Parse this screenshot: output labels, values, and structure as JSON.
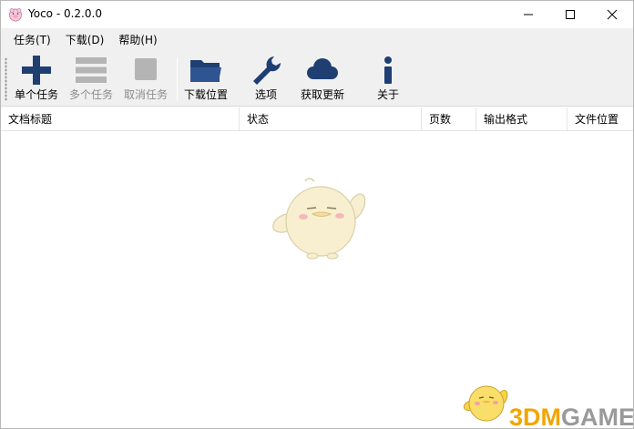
{
  "window": {
    "title": "Yoco - 0.2.0.0",
    "icon": "pink-piglet-app-icon"
  },
  "menu": [
    {
      "label": "任务(T)"
    },
    {
      "label": "下载(D)"
    },
    {
      "label": "帮助(H)"
    }
  ],
  "toolbar": {
    "items": [
      {
        "label": "单个任务",
        "icon": "plus-icon",
        "enabled": true
      },
      {
        "label": "多个任务",
        "icon": "list-icon",
        "enabled": false
      },
      {
        "label": "取消任务",
        "icon": "stop-icon",
        "enabled": false
      },
      {
        "label": "下载位置",
        "icon": "folder-icon",
        "enabled": true
      },
      {
        "label": "选项",
        "icon": "wrench-icon",
        "enabled": true
      },
      {
        "label": "获取更新",
        "icon": "cloud-icon",
        "enabled": true
      },
      {
        "label": "关于",
        "icon": "info-icon",
        "enabled": true
      }
    ],
    "accent_color": "#1f3f73"
  },
  "table": {
    "columns": [
      "文档标题",
      "状态",
      "页数",
      "输出格式",
      "文件位置"
    ],
    "rows": []
  },
  "watermark": {
    "part1": "3DM",
    "part2": "GAME"
  }
}
